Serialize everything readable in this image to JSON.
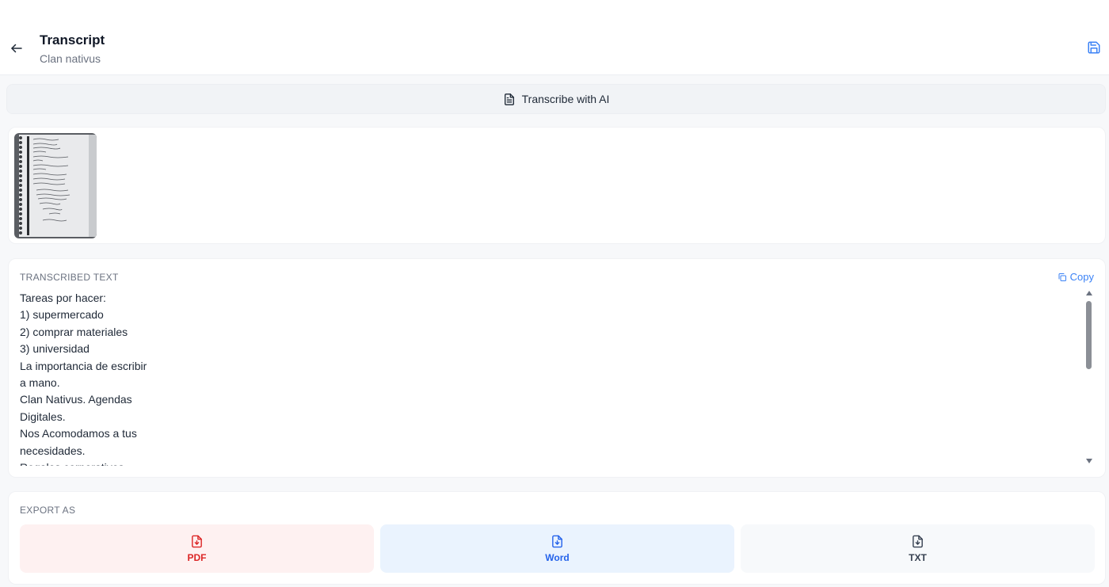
{
  "header": {
    "title": "Transcript",
    "subtitle": "Clan nativus"
  },
  "actions": {
    "transcribe_label": "Transcribe with AI"
  },
  "transcription": {
    "label": "TRANSCRIBED TEXT",
    "copy_label": "Copy",
    "lines": [
      "Tareas por hacer:",
      "1) supermercado",
      "2) comprar materiales",
      "3) universidad",
      "La importancia de escribir",
      "a mano.",
      "Clan Nativus. Agendas",
      "Digitales.",
      "Nos Acomodamos a tus",
      "necesidades.",
      "Regalos corporativos."
    ]
  },
  "export": {
    "label": "EXPORT AS",
    "options": [
      {
        "label": "PDF",
        "color": "#dc2626",
        "bg": "#fef1f1"
      },
      {
        "label": "Word",
        "color": "#2563eb",
        "bg": "#eaf3fe"
      },
      {
        "label": "TXT",
        "color": "#374151",
        "bg": "#f7f9fb"
      }
    ]
  },
  "colors": {
    "accent": "#3b82f6"
  }
}
